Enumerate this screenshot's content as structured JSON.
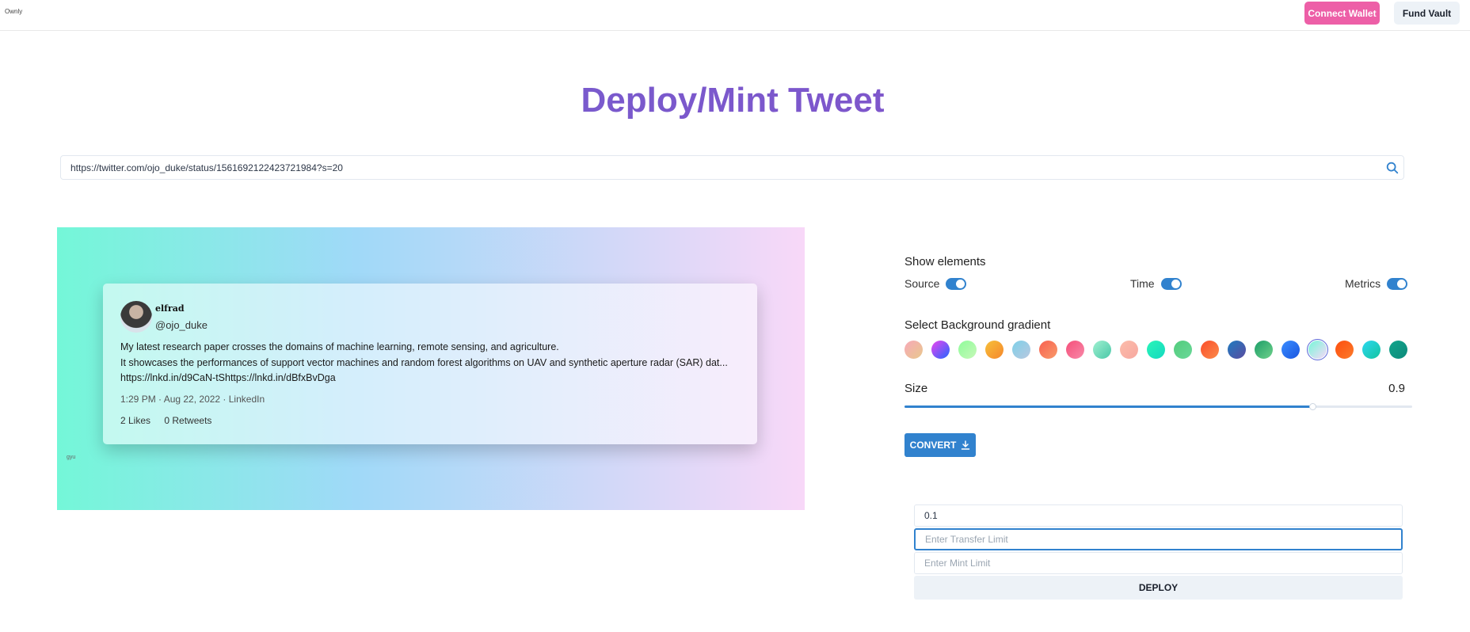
{
  "header": {
    "brand": "Ownly",
    "connect_wallet_label": "Connect Wallet",
    "fund_vault_label": "Fund Vault",
    "connect_color": "#ed5fa7"
  },
  "page": {
    "title": "Deploy/Mint Tweet"
  },
  "search": {
    "url_value": "https://twitter.com/ojo_duke/status/1561692122423721984?s=20",
    "icon": "search-icon"
  },
  "tweet": {
    "name": "elfrad",
    "handle": "@ojo_duke",
    "text_lines": [
      "My latest research paper crosses the domains of machine learning, remote sensing, and agriculture.",
      "It showcases the performances of support vector machines and random forest algorithms on UAV and synthetic aperture radar (SAR) dat...",
      "https://lnkd.in/d9CaN-tShttps://lnkd.in/dBfxBvDga"
    ],
    "time": "1:29 PM · Aug 22, 2022 · LinkedIn",
    "likes": "2 Likes",
    "retweets": "0 Retweets",
    "watermark": "gyu"
  },
  "controls": {
    "show_elements_label": "Show elements",
    "toggles": [
      {
        "label": "Source",
        "on": true
      },
      {
        "label": "Time",
        "on": true
      },
      {
        "label": "Metrics",
        "on": true
      }
    ],
    "gradient_label": "Select Background gradient",
    "gradients": [
      [
        "#f7a9b8",
        "#e8c88c"
      ],
      [
        "#ee44ee",
        "#2266ff"
      ],
      [
        "#8efc9a",
        "#c6f8b8"
      ],
      [
        "#f7c03a",
        "#f5872c"
      ],
      [
        "#7ed0e8",
        "#b8c8e0"
      ],
      [
        "#f86050",
        "#f89a6a"
      ],
      [
        "#f54f7a",
        "#f888a8"
      ],
      [
        "#9ff0d0",
        "#4bc8a8"
      ],
      [
        "#fcbcaa",
        "#f7a8a0"
      ],
      [
        "#2af5b8",
        "#14d9c0"
      ],
      [
        "#52cc7c",
        "#6ad898"
      ],
      [
        "#fb4e2a",
        "#fb8a4a"
      ],
      [
        "#1f7bc0",
        "#5a4ca0"
      ],
      [
        "#1d9e68",
        "#6ed08a"
      ],
      [
        "#3a8dff",
        "#1a56e0"
      ],
      [
        "#74f7d8",
        "#f8d8f8"
      ],
      [
        "#fe4e0e",
        "#fb7a2a"
      ],
      [
        "#2cd8f0",
        "#14c4a0"
      ],
      [
        "#12a58c",
        "#0d8a7a"
      ]
    ],
    "selected_gradient": 15,
    "size_label": "Size",
    "size_value": "0.9",
    "convert_label": "CONVERT"
  },
  "deploy": {
    "price_value": "0.1",
    "transfer_limit_placeholder": "Enter Transfer Limit",
    "mint_limit_placeholder": "Enter Mint Limit",
    "deploy_label": "DEPLOY"
  }
}
